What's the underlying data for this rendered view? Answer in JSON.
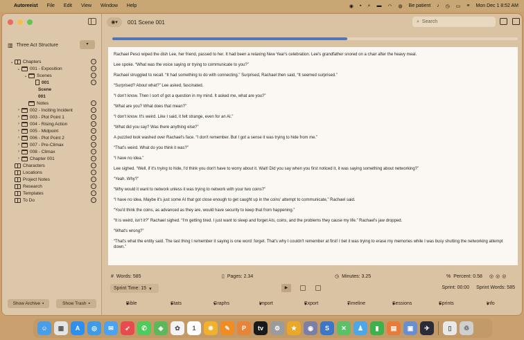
{
  "menubar": {
    "app_name": "Autoreeist",
    "items": [
      "File",
      "Edit",
      "View",
      "Window",
      "Help"
    ],
    "focus": "Be patient",
    "datetime": "Mon Dec 1  8:52 AM"
  },
  "window": {
    "doc_title": "001 Scene 001",
    "search_placeholder": "Search"
  },
  "sidebar": {
    "structure_label": "Three Act Structure",
    "tree": [
      {
        "label": "Chapters",
        "icon": "book-icon",
        "indent": 0,
        "disclosure": "v"
      },
      {
        "label": "001 - Exposition",
        "icon": "folder-icon",
        "indent": 1,
        "disclosure": "v"
      },
      {
        "label": "Scenes",
        "icon": "folder-icon",
        "indent": 2,
        "disclosure": "v"
      },
      {
        "label": "001",
        "icon": "doc-icon",
        "indent": 3,
        "disclosure": "",
        "bold": true
      },
      {
        "label": "Scene",
        "icon": "",
        "indent": 3,
        "disclosure": "",
        "bold": true,
        "cont": true
      },
      {
        "label": "001",
        "icon": "",
        "indent": 3,
        "disclosure": "",
        "bold": true,
        "cont": true
      },
      {
        "label": "Notes",
        "icon": "folder-icon",
        "indent": 2,
        "disclosure": ""
      },
      {
        "label": "002 - Inciting Incident",
        "icon": "folder-icon",
        "indent": 1,
        "disclosure": ">"
      },
      {
        "label": "003 - Plot Point 1",
        "icon": "folder-icon",
        "indent": 1,
        "disclosure": ">"
      },
      {
        "label": "004 - Rising Action",
        "icon": "folder-icon",
        "indent": 1,
        "disclosure": ">"
      },
      {
        "label": "005 - Midpoint",
        "icon": "folder-icon",
        "indent": 1,
        "disclosure": ">"
      },
      {
        "label": "006 - Plot Point 2",
        "icon": "folder-icon",
        "indent": 1,
        "disclosure": ">"
      },
      {
        "label": "007 - Pre-Climax",
        "icon": "folder-icon",
        "indent": 1,
        "disclosure": ">"
      },
      {
        "label": "008 - Climax",
        "icon": "folder-icon",
        "indent": 1,
        "disclosure": ">"
      },
      {
        "label": "Chapter 001",
        "icon": "folder-icon",
        "indent": 1,
        "disclosure": ">"
      },
      {
        "label": "Characters",
        "icon": "book-icon",
        "indent": 0,
        "disclosure": ""
      },
      {
        "label": "Locations",
        "icon": "book-icon",
        "indent": 0,
        "disclosure": ""
      },
      {
        "label": "Project Notes",
        "icon": "book-icon",
        "indent": 0,
        "disclosure": ""
      },
      {
        "label": "Research",
        "icon": "book-icon",
        "indent": 0,
        "disclosure": ""
      },
      {
        "label": "Templates",
        "icon": "book-icon",
        "indent": 0,
        "disclosure": ""
      },
      {
        "label": "To Do",
        "icon": "book-icon",
        "indent": 0,
        "disclosure": ""
      }
    ],
    "show_archive": "Show Archive",
    "show_trash": "Show Trash"
  },
  "editor": {
    "progress_fraction": 0.58,
    "paragraphs": [
      "Rachael Pesci wiped the dish Lee, her friend, passed to her. It had been a relaxing New Year's celebration. Lee's grandfather snored on a chair after the heavy meal.",
      "Lee spoke. “What was the voice saying or trying to communicate to you?”",
      "Rachael struggled to recall. “It had something to do with connecting.” Surprised, Rachael then said, “It seemed surprised.”",
      "“Surprised? About what?” Lee asked, fascinated.",
      "“I don't know. Then I sort of got a question in my mind. It asked me, what are you?”",
      "“What are you? What does that mean?”",
      "“I don't know. It's weird. Like I said, it felt strange, even for an AI.”",
      "“What did you say? Was there anything else?”",
      "A puzzled look washed over Rachael's face. “I don't remember. But I got a sense it was trying to hide from me.”",
      "“That's weird. What do you think it was?”",
      "“I have no idea.”",
      "Lee sighed. “Well, if it's trying to hide, I'd think you don't have to worry about it. Wait! Did you say when you first noticed it, it was saying something about networking?”",
      "“Yeah. Why?”",
      "“Why would it want to network unless it was trying to network with your two coins?”",
      "“I have no idea. Maybe it's just some AI that got close enough to get caught up in the coins' attempt to communicate,” Rachael said.",
      "“You'd think the coins, as advanced as they are, would have security to keep that from happening.”",
      "“It is weird, isn't it?” Rachael sighed. “I'm getting tired. I just want to sleep and forget AIs, coins, and the problems they cause my life.” Rachael's jaw dropped.",
      "“What's wrong?”",
      "“That's what the entity said. The last thing I remember it saying is one word: forget. That's why I couldn't remember at first! I bet it was trying to erase my memories while I was busy shutting the networking attempt down.”"
    ]
  },
  "stats": {
    "words": "Words: 585",
    "pages": "Pages: 2.34",
    "minutes": "Minutes: 3.25",
    "percent": "Percent: 0.58"
  },
  "sprint": {
    "time_select": "Sprint Time: 15",
    "sprint_time": "Sprint: 00:00",
    "sprint_words": "Sprint Words: 585"
  },
  "bottom_menus": [
    "Bible",
    "Stats",
    "Graphs",
    "Import",
    "Export",
    "Timeline",
    "Sessions",
    "Sprints",
    "Info"
  ],
  "dock": [
    {
      "name": "finder",
      "color": "#4a9ee8",
      "glyph": "☺"
    },
    {
      "name": "launchpad",
      "color": "#e4e4e4",
      "glyph": "▦"
    },
    {
      "name": "app-store",
      "color": "#2f8ff0",
      "glyph": "A"
    },
    {
      "name": "safari",
      "color": "#3e9be9",
      "glyph": "◎"
    },
    {
      "name": "mail",
      "color": "#4aa2f0",
      "glyph": "✉"
    },
    {
      "name": "rocket",
      "color": "#e84b4b",
      "glyph": "➶"
    },
    {
      "name": "messages",
      "color": "#4ecb5a",
      "glyph": "✆"
    },
    {
      "name": "maps",
      "color": "#5bb85b",
      "glyph": "◈"
    },
    {
      "name": "photos",
      "color": "#f3f3f3",
      "glyph": "✿"
    },
    {
      "name": "calendar",
      "color": "#ffffff",
      "glyph": "1"
    },
    {
      "name": "butterfly",
      "color": "#f0b12e",
      "glyph": "❋"
    },
    {
      "name": "pages-app",
      "color": "#f28b22",
      "glyph": "✎"
    },
    {
      "name": "writer-app",
      "color": "#e8833a",
      "glyph": "P"
    },
    {
      "name": "apple-tv",
      "color": "#1a1a1a",
      "glyph": "tv"
    },
    {
      "name": "settings",
      "color": "#9b9b9b",
      "glyph": "⚙"
    },
    {
      "name": "star-app",
      "color": "#e9a82a",
      "glyph": "★"
    },
    {
      "name": "alien-app",
      "color": "#7b7fa6",
      "glyph": "◉"
    },
    {
      "name": "scrivener",
      "color": "#3c76c8",
      "glyph": "S"
    },
    {
      "name": "xcode",
      "color": "#5cbf6a",
      "glyph": "✕"
    },
    {
      "name": "astronaut",
      "color": "#4aa8e8",
      "glyph": "♟"
    },
    {
      "name": "numbers",
      "color": "#3fb04c",
      "glyph": "▮"
    },
    {
      "name": "books-app",
      "color": "#e87b3a",
      "glyph": "▤"
    },
    {
      "name": "preview",
      "color": "#6a8fd0",
      "glyph": "▣"
    },
    {
      "name": "swift",
      "color": "#2b2b3a",
      "glyph": "✈"
    },
    {
      "name": "document",
      "color": "#e8e8e8",
      "glyph": "▯"
    },
    {
      "name": "trash",
      "color": "#cfcfcf",
      "glyph": "♲"
    }
  ]
}
